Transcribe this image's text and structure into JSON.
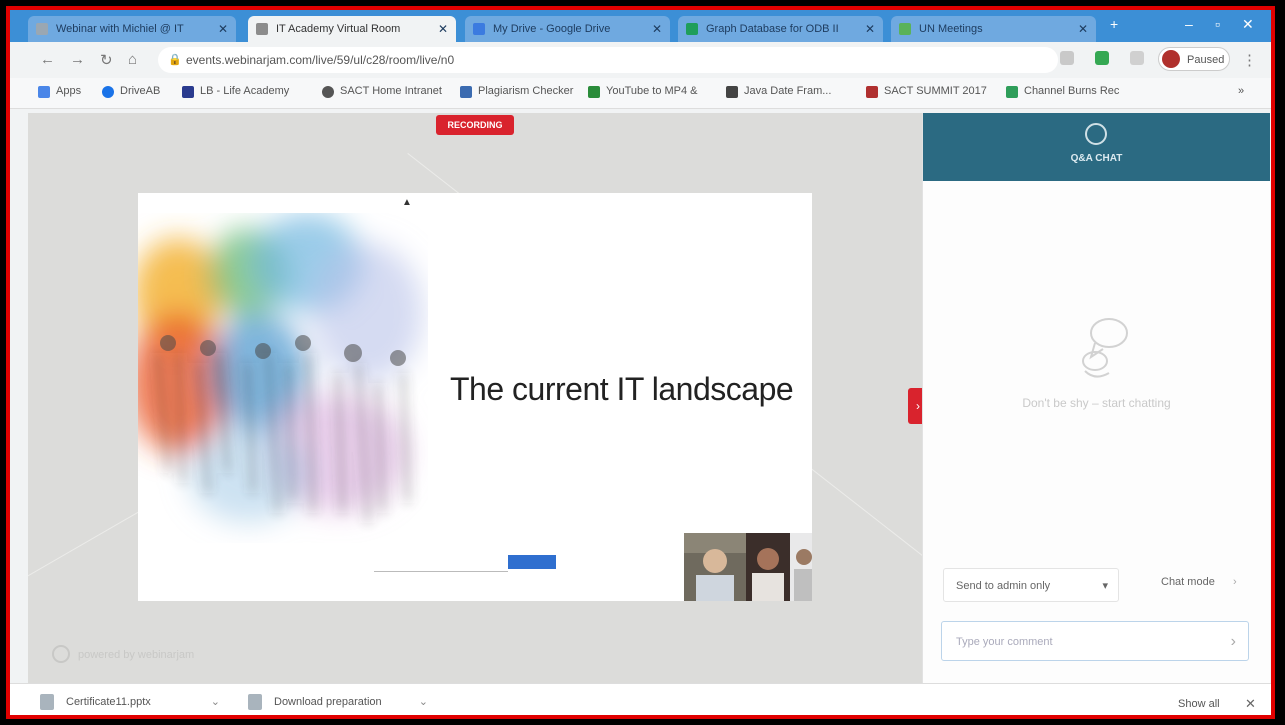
{
  "browser": {
    "tabs": [
      {
        "title": "Webinar with Michiel @ IT",
        "active": false,
        "color": "#9aa7b2"
      },
      {
        "title": "IT Academy Virtual Room",
        "active": true,
        "color": "#8c8c8c"
      },
      {
        "title": "My Drive - Google Drive",
        "active": false,
        "color": "#3b7be0"
      },
      {
        "title": "Graph Database for ODB II",
        "active": false,
        "color": "#1f9e5a"
      },
      {
        "title": "UN Meetings",
        "active": false,
        "color": "#5ab25a"
      }
    ],
    "url": "events.webinarjam.com/live/59/ul/c28/room/live/n0",
    "profile_label": "Paused"
  },
  "bookmarks": [
    {
      "label": "Apps",
      "color": "#4a86e8"
    },
    {
      "label": "DriveAB",
      "color": "#1a73e8"
    },
    {
      "label": "LB - Life Academy",
      "color": "#2a3b8f"
    },
    {
      "label": "SACT Home Intranet",
      "color": "#555555"
    },
    {
      "label": "Plagiarism Checker",
      "color": "#3b6bb0"
    },
    {
      "label": "YouTube to MP4 &",
      "color": "#2a8c3a"
    },
    {
      "label": "Java Date Fram...",
      "color": "#444444"
    },
    {
      "label": "SACT SUMMIT 2017",
      "color": "#b03030"
    },
    {
      "label": "Channel Burns Rec",
      "color": "#2f9e5a"
    }
  ],
  "room": {
    "recording_label": "RECORDING",
    "brand_text": "powered by webinarjam",
    "side_tab_label": "›"
  },
  "slide": {
    "title": "The current IT landscape"
  },
  "panel": {
    "header_label": "Q&A CHAT",
    "empty_text": "Don't be shy – start chatting",
    "send_to_label": "Send to admin only",
    "chat_mode_label": "Chat mode",
    "message_placeholder": "Type your comment"
  },
  "downloads": {
    "items": [
      {
        "label": "Certificate11.pptx"
      },
      {
        "label": "Download preparation"
      }
    ],
    "show_all_label": "Show all"
  }
}
